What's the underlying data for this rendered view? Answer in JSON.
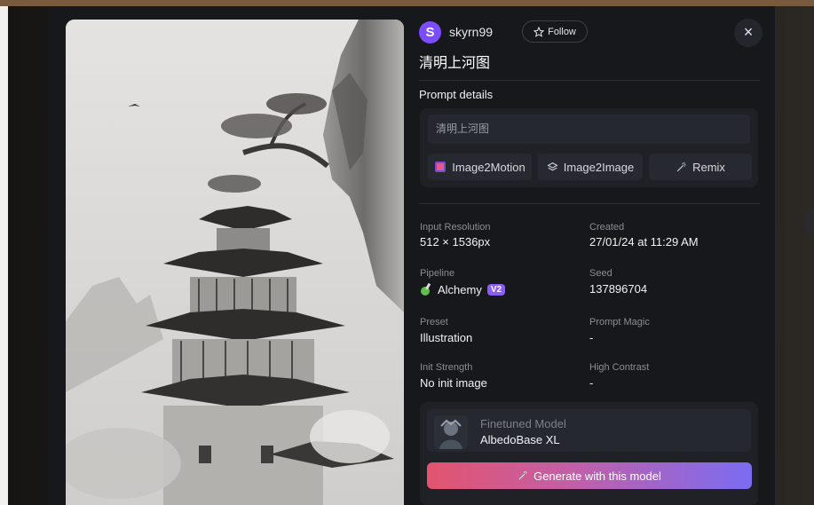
{
  "author": {
    "avatar_letter": "S",
    "username": "skyrn99",
    "follow_label": "Follow"
  },
  "close_icon": "×",
  "title": "清明上河图",
  "prompt_details": {
    "heading": "Prompt details",
    "prompt_text": "清明上河图",
    "actions": [
      {
        "label": "Image2Motion",
        "icon": "film-icon"
      },
      {
        "label": "Image2Image",
        "icon": "layers-icon"
      },
      {
        "label": "Remix",
        "icon": "magic-wand-icon"
      }
    ]
  },
  "meta": {
    "input_resolution": {
      "label": "Input Resolution",
      "value": "512 × 1536px"
    },
    "created": {
      "label": "Created",
      "value": "27/01/24 at 11:29 AM"
    },
    "pipeline": {
      "label": "Pipeline",
      "value": "Alchemy",
      "badge": "V2"
    },
    "seed": {
      "label": "Seed",
      "value": "137896704"
    },
    "preset": {
      "label": "Preset",
      "value": "Illustration"
    },
    "prompt_magic": {
      "label": "Prompt Magic",
      "value": "-"
    },
    "init_strength": {
      "label": "Init Strength",
      "value": "No init image"
    },
    "high_contrast": {
      "label": "High Contrast",
      "value": "-"
    }
  },
  "model": {
    "label": "Finetuned Model",
    "name": "AlbedoBase XL",
    "generate_label": "Generate with this model"
  },
  "colors": {
    "accent_purple": "#8b5cf6",
    "gradient_start": "#e2546e",
    "gradient_end": "#7a6cf2",
    "panel_bg": "#17181c"
  }
}
